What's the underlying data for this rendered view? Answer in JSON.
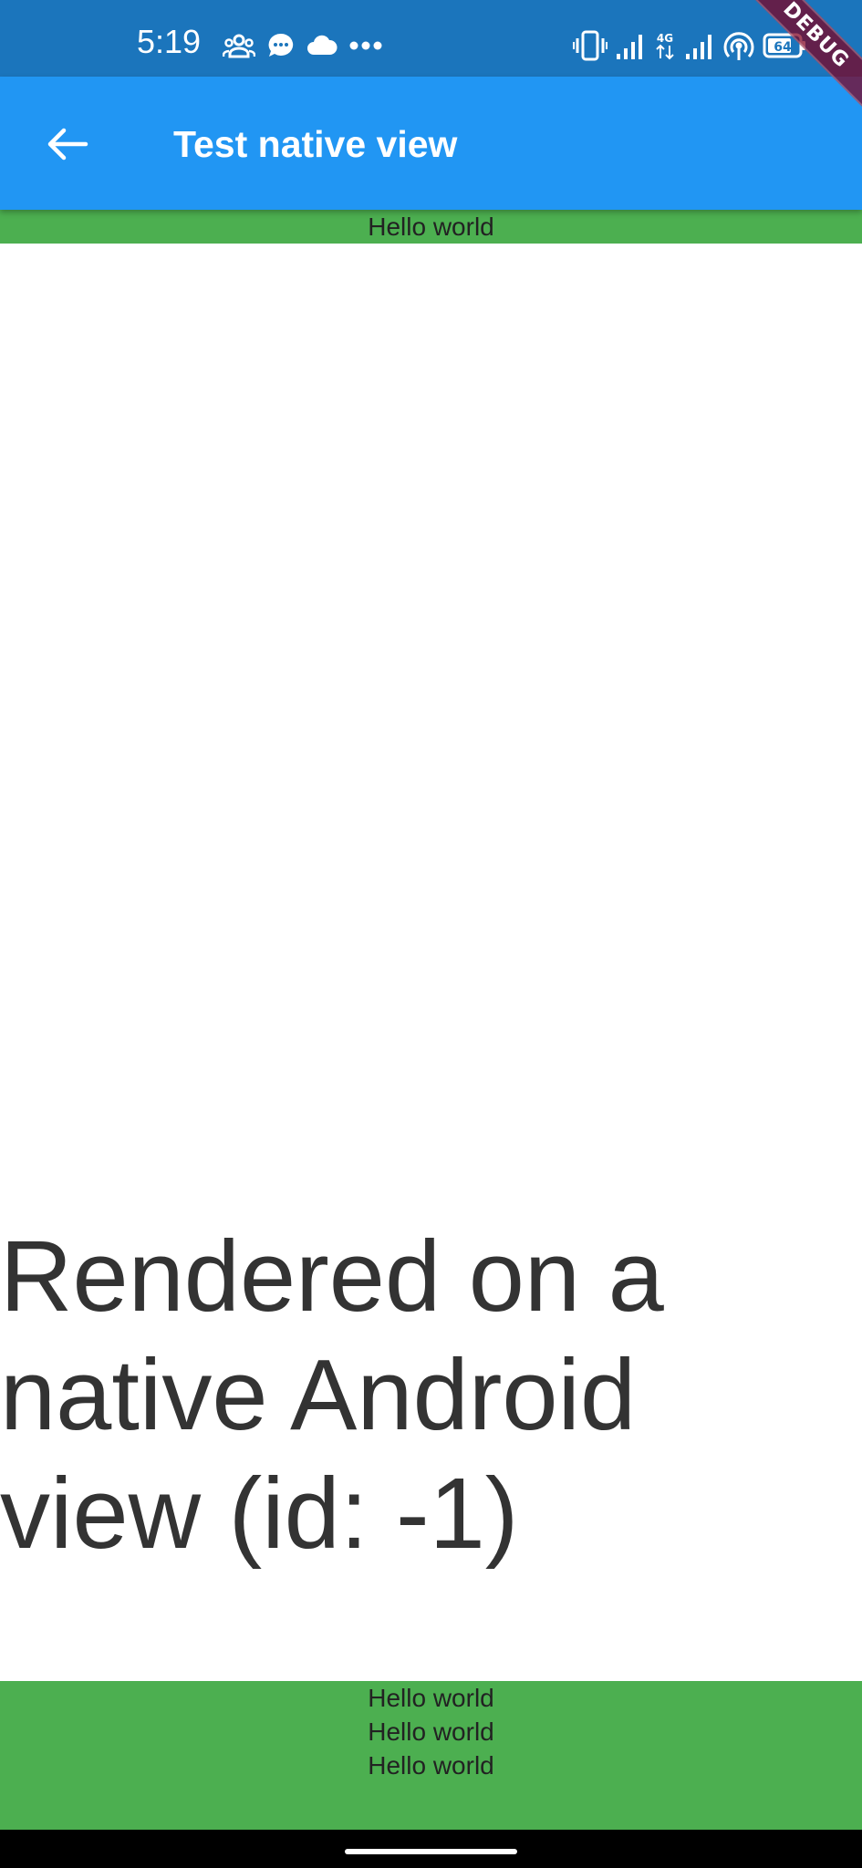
{
  "status_bar": {
    "time": "5:19",
    "battery": "64",
    "network": "4G",
    "left_icons": [
      "group-icon",
      "chat-bubble-icon",
      "cloud-icon",
      "more-dots-icon"
    ],
    "right_icons": [
      "vibrate-icon",
      "signal-icon",
      "mobile-data-4g-icon",
      "signal-icon",
      "hotspot-icon",
      "battery-icon"
    ]
  },
  "app_bar": {
    "title": "Test native view",
    "back_icon": "arrow-back-icon",
    "background_color": "#2196f3"
  },
  "debug_banner": {
    "label": "DEBUG"
  },
  "top_strip": {
    "text": "Hello world",
    "color": "#4caf50"
  },
  "native_view": {
    "text": "Rendered on a native Android view (id: -1)"
  },
  "bottom_strip": {
    "lines": [
      "Hello world",
      "Hello world",
      "Hello world"
    ],
    "color": "#4caf50"
  }
}
